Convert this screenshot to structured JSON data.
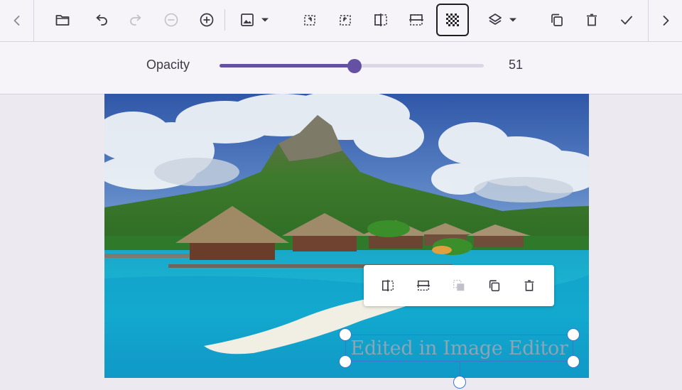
{
  "toolbar": {
    "active_tool": "transparency",
    "tools": [
      "open",
      "undo",
      "redo",
      "zoom-out",
      "zoom-in",
      "image",
      "rotate-left",
      "rotate-right",
      "flip-horizontal",
      "flip-vertical",
      "transparency",
      "z-order",
      "duplicate",
      "delete",
      "ok"
    ]
  },
  "opacity": {
    "label": "Opacity",
    "value": "51",
    "fraction": 0.51
  },
  "annotation": {
    "text": "Edited in Image Editor"
  },
  "colors": {
    "accent": "#6650a4",
    "selection": "#3b78c9",
    "toolbar_bg": "#f6f4f9",
    "page_bg": "#ece9f1"
  }
}
